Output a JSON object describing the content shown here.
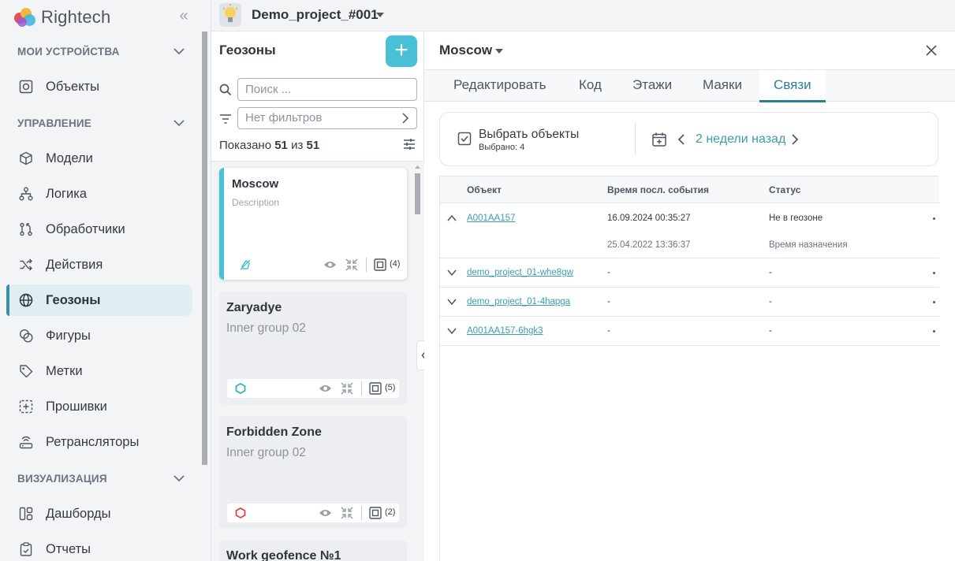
{
  "app": {
    "brand": "Rightech"
  },
  "sidebar": {
    "sections": [
      {
        "label": "МОИ УСТРОЙСТВА"
      },
      {
        "label": "УПРАВЛЕНИЕ"
      },
      {
        "label": "ВИЗУАЛИЗАЦИЯ"
      }
    ],
    "items": [
      {
        "label": "Объекты",
        "icon": "objects-icon"
      },
      {
        "label": "Модели",
        "icon": "cube-icon"
      },
      {
        "label": "Логика",
        "icon": "logic-tree-icon"
      },
      {
        "label": "Обработчики",
        "icon": "handlers-icon"
      },
      {
        "label": "Действия",
        "icon": "shuffle-icon"
      },
      {
        "label": "Геозоны",
        "icon": "globe-icon",
        "active": true
      },
      {
        "label": "Фигуры",
        "icon": "shapes-icon"
      },
      {
        "label": "Метки",
        "icon": "tag-icon"
      },
      {
        "label": "Прошивки",
        "icon": "firmware-icon"
      },
      {
        "label": "Ретрансляторы",
        "icon": "router-icon"
      },
      {
        "label": "Дашборды",
        "icon": "dashboard-icon"
      },
      {
        "label": "Отчеты",
        "icon": "report-icon"
      }
    ]
  },
  "topbar": {
    "project_name": "Demo_project_#001"
  },
  "geofences": {
    "title": "Геозоны",
    "add_label": "+",
    "search_placeholder": "Поиск ...",
    "filter_placeholder": "Нет фильтров",
    "count_prefix": "Показано",
    "count_shown": "51",
    "count_sep": "из",
    "count_total": "51",
    "cards": [
      {
        "name": "Moscow",
        "description": "Description",
        "shape_color": "#48c0d6",
        "objects": "(4)"
      },
      {
        "name": "Zaryadye",
        "description": "Inner group 02",
        "shape_color": "#2bb3c0",
        "objects": "(5)"
      },
      {
        "name": "Forbidden Zone",
        "description": "Inner group 02",
        "shape_color": "#e0453a",
        "objects": "(2)"
      },
      {
        "name": "Work geofence №1",
        "description": "",
        "shape_color": "#48c0d6",
        "objects": ""
      }
    ]
  },
  "detail": {
    "title": "Moscow",
    "tabs": [
      "Редактировать",
      "Код",
      "Этажи",
      "Маяки",
      "Связи"
    ],
    "active_tab": "Связи",
    "select_label": "Выбрать объекты",
    "selected_count": "Выбрано: 4",
    "period": "2 недели назад",
    "table": {
      "headers": [
        "Объект",
        "Время посл. события",
        "Статус"
      ],
      "rows": [
        {
          "object": "A001AA157",
          "time": "16.09.2024 00:35:27",
          "status": "Не в геозоне",
          "expanded": true,
          "sub_time": "25.04.2022 13:36:37",
          "sub_label": "Время назначения"
        },
        {
          "object": "demo_project_01-whe8gw",
          "time": "-",
          "status": "-"
        },
        {
          "object": "demo_project_01-4hapga",
          "time": "-",
          "status": "-"
        },
        {
          "object": "A001AA157-6hgk3",
          "time": "-",
          "status": "-"
        }
      ]
    }
  },
  "colors": {
    "accent": "#48c0d6",
    "link": "#3a9cb3",
    "active_tab": "#2b7f95",
    "active_nav_bg": "#e0eef2"
  }
}
